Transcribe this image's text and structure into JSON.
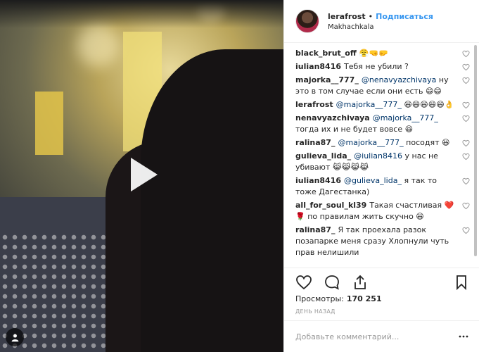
{
  "post": {
    "author": "lerafrost",
    "follow_label": "Подписаться",
    "location": "Makhachkala"
  },
  "comments": [
    {
      "user": "black_brut_off",
      "text": "",
      "emojis": "😤🤜🤛"
    },
    {
      "user": "iulian8416",
      "text": "Тебя не убили ?",
      "emojis": ""
    },
    {
      "user": "majorka__777_",
      "mention": "@nenavyazchivaya",
      "text": "ну это в том случае если они есть",
      "emojis": "😄😄"
    },
    {
      "user": "lerafrost",
      "mention": "@majorka__777_",
      "text": "",
      "emojis": "😄😄😄😄😄👌"
    },
    {
      "user": "nenavyazchivaya",
      "mention": "@majorka__777_",
      "text": "тогда их и не будет вовсе",
      "emojis": "😆"
    },
    {
      "user": "ralina87_",
      "mention": "@majorka__777_",
      "text": "посодят",
      "emojis": "😆"
    },
    {
      "user": "gulieva_lida_",
      "mention": "@iulian8416",
      "text": "у нас не убивают",
      "emojis": "😹😹😹😹"
    },
    {
      "user": "iulian8416",
      "mention": "@gulieva_lida_",
      "text": "я так то тоже Дагестанка)",
      "emojis": ""
    },
    {
      "user": "all_for_soul_kl39",
      "text": "Такая счастливая",
      "emojis_after_text": "❤️",
      "extra": "🌹 по правилам жить скучно",
      "emojis": "😄"
    },
    {
      "user": "ralina87_",
      "text": "Я так проехала разок позапарке меня сразу Хлопнули чуть прав нелишили",
      "emojis": ""
    }
  ],
  "stats": {
    "views_label": "Просмотры:",
    "views_count": "170 251",
    "time_ago": "день назад"
  },
  "composer": {
    "placeholder": "Добавьте комментарий..."
  },
  "icons": {
    "play": "play-icon",
    "sound": "sound-icon",
    "like": "heart-icon",
    "comment": "comment-icon",
    "share": "share-icon",
    "save": "bookmark-icon",
    "more": "more-icon"
  }
}
